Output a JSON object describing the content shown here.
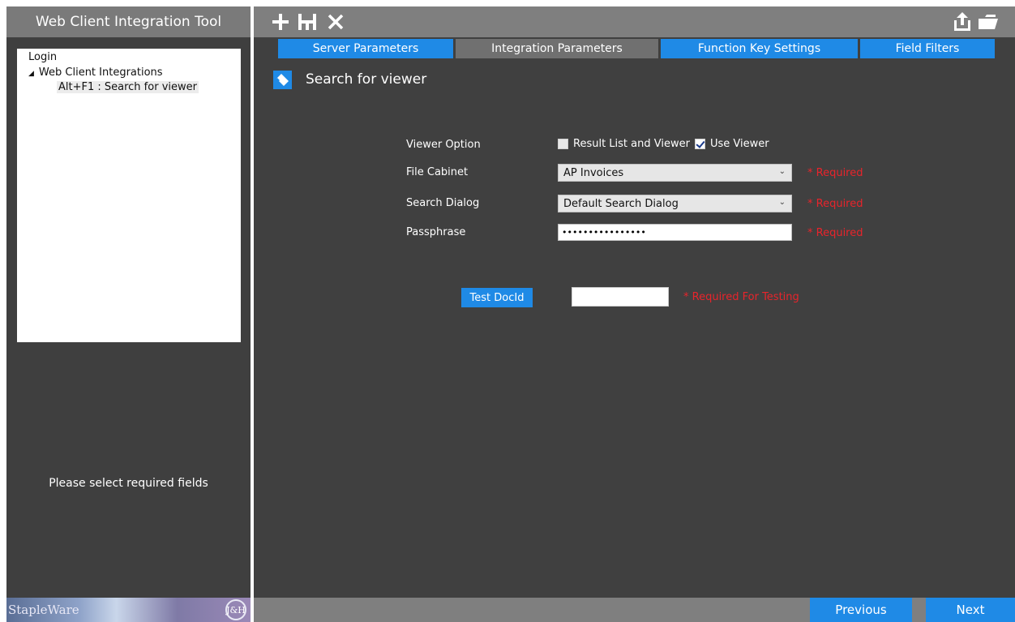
{
  "sidebar": {
    "title": "Web Client Integration Tool",
    "tree": {
      "login": "Login",
      "integrations": "Web Client Integrations",
      "selected_item": "Alt+F1 : Search for viewer"
    },
    "hint": "Please select required fields",
    "logo_text": "StapleWare",
    "logo_mark": "J&H"
  },
  "toolbar": {
    "icons": [
      "add-icon",
      "save-icon",
      "close-icon",
      "export-icon",
      "folder-icon"
    ]
  },
  "tabs": [
    {
      "label": "Server Parameters",
      "active": false
    },
    {
      "label": "Integration Parameters",
      "active": true
    },
    {
      "label": "Function Key Settings",
      "active": false
    },
    {
      "label": "Field Filters",
      "active": false
    }
  ],
  "page": {
    "title": "Search for viewer",
    "icon": "pencil-icon"
  },
  "form": {
    "viewer_option": {
      "label": "Viewer Option",
      "opt1": {
        "label": "Result List and Viewer",
        "checked": false
      },
      "opt2": {
        "label": "Use Viewer",
        "checked": true
      }
    },
    "file_cabinet": {
      "label": "File Cabinet",
      "value": "AP Invoices",
      "required": "* Required"
    },
    "search_dialog": {
      "label": "Search Dialog",
      "value": "Default Search Dialog",
      "required": "* Required"
    },
    "passphrase": {
      "label": "Passphrase",
      "value": "••••••••••••••••",
      "required": "* Required"
    },
    "test_docid": {
      "button": "Test DocId",
      "value": "",
      "required": "* Required For Testing"
    }
  },
  "bottom": {
    "previous": "Previous",
    "next": "Next"
  },
  "colors": {
    "accent": "#1f8ae6",
    "required": "#e8242b",
    "panel": "#404040",
    "bar": "#7f7f7f"
  }
}
